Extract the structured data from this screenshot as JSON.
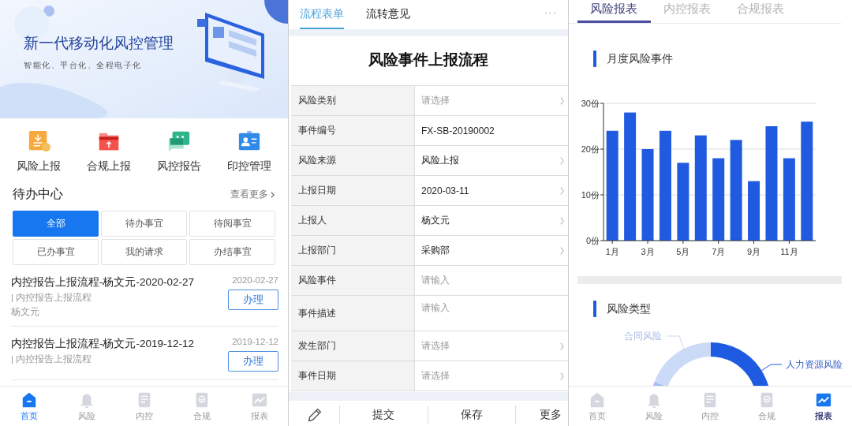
{
  "home": {
    "banner": {
      "title": "新一代移动化风控管理",
      "subtitle": "智能化、平台化、全程电子化"
    },
    "quick_actions": [
      {
        "label": "风险上报",
        "kind": "upload"
      },
      {
        "label": "合规上报",
        "kind": "folder"
      },
      {
        "label": "风控报告",
        "kind": "chat"
      },
      {
        "label": "印控管理",
        "kind": "card"
      }
    ],
    "todo": {
      "title": "待办中心",
      "more": "查看更多",
      "filters": [
        {
          "label": "全部",
          "selected": true
        },
        {
          "label": "待办事宜",
          "selected": false
        },
        {
          "label": "待阅事宜",
          "selected": false
        },
        {
          "label": "已办事宜",
          "selected": false
        },
        {
          "label": "我的请求",
          "selected": false
        },
        {
          "label": "办结事宜",
          "selected": false
        }
      ],
      "items": [
        {
          "title": "内控报告上报流程-杨文元-2020-02-27",
          "date": "2020-02-27",
          "flow": "| 内控报告上报流程",
          "author": "杨文元",
          "action": "办理"
        },
        {
          "title": "内控报告上报流程-杨文元-2019-12-12",
          "date": "2019-12-12",
          "flow": "| 内控报告上报流程",
          "action": "办理"
        }
      ]
    },
    "tab_bar": [
      {
        "label": "首页",
        "kind": "home",
        "selected": true
      },
      {
        "label": "风险",
        "kind": "bell",
        "selected": false
      },
      {
        "label": "内控",
        "kind": "doc",
        "selected": false
      },
      {
        "label": "合规",
        "kind": "check",
        "selected": false
      },
      {
        "label": "报表",
        "kind": "chart",
        "selected": false
      }
    ]
  },
  "form": {
    "tabs": [
      {
        "label": "流程表单",
        "selected": true
      },
      {
        "label": "流转意见",
        "selected": false
      }
    ],
    "more": "···",
    "title": "风险事件上报流程",
    "rows": [
      {
        "label": "风险类别",
        "placeholder": "请选择",
        "arrow": true,
        "kind": "line"
      },
      {
        "label": "事件编号",
        "value": "FX-SB-20190002",
        "arrow": false,
        "kind": "line"
      },
      {
        "label": "风险来源",
        "value": "风险上报",
        "arrow": true,
        "kind": "line"
      },
      {
        "label": "上报日期",
        "value": "2020-03-11",
        "arrow": true,
        "kind": "line"
      },
      {
        "label": "上报人",
        "value": "杨文元",
        "arrow": true,
        "kind": "line"
      },
      {
        "label": "上报部门",
        "value": "采购部",
        "arrow": true,
        "kind": "line"
      },
      {
        "label": "风险事件",
        "placeholder": "请输入",
        "arrow": false,
        "kind": "line"
      },
      {
        "label": "事件描述",
        "placeholder": "请输入",
        "arrow": false,
        "kind": "textarea"
      },
      {
        "label": "发生部门",
        "placeholder": "请选择",
        "arrow": true,
        "kind": "line"
      },
      {
        "label": "事件日期",
        "placeholder": "请选择",
        "arrow": true,
        "kind": "line"
      }
    ],
    "actions": [
      "提交",
      "保存",
      "更多"
    ]
  },
  "reports": {
    "tabs": [
      {
        "label": "风险报表",
        "selected": true
      },
      {
        "label": "内控报表",
        "selected": false
      },
      {
        "label": "合规报表",
        "selected": false
      }
    ],
    "monthly": {
      "title": "月度风险事件",
      "chart_data": {
        "type": "bar",
        "x": [
          1,
          2,
          3,
          4,
          5,
          6,
          7,
          8,
          9,
          10,
          11,
          12
        ],
        "xlim": [
          0.5,
          12.5
        ],
        "series": [
          {
            "color": "#1f5ae0",
            "values": [
              24,
              28,
              20,
              24,
              17,
              23,
              18,
              22,
              13,
              25,
              18,
              26
            ]
          }
        ],
        "ylim": [
          0,
          30
        ],
        "yticks": [
          {
            "value": 0,
            "label": "0份"
          },
          {
            "value": 10,
            "label": "10份"
          },
          {
            "value": 20,
            "label": "20份"
          },
          {
            "value": 30,
            "label": "30份"
          }
        ],
        "xticks": [
          {
            "value": 1,
            "label": "1月"
          },
          {
            "value": 3,
            "label": "3月"
          },
          {
            "value": 5,
            "label": "5月"
          },
          {
            "value": 7,
            "label": "7月"
          },
          {
            "value": 9,
            "label": "9月"
          },
          {
            "value": 11,
            "label": "11月"
          }
        ]
      }
    },
    "types": {
      "title": "风险类型",
      "segments": [
        {
          "color": "#a6bff2"
        },
        {
          "label": "合同风险",
          "color": "#cbdaf7"
        },
        {
          "label": "人力资源风险",
          "color": "#1e5be0"
        }
      ]
    },
    "tab_bar": [
      {
        "label": "首页",
        "kind": "home",
        "selected": false
      },
      {
        "label": "风险",
        "kind": "bell",
        "selected": false
      },
      {
        "label": "内控",
        "kind": "doc",
        "selected": false
      },
      {
        "label": "合规",
        "kind": "check",
        "selected": false
      },
      {
        "label": "报表",
        "kind": "chart",
        "selected": true
      }
    ]
  }
}
